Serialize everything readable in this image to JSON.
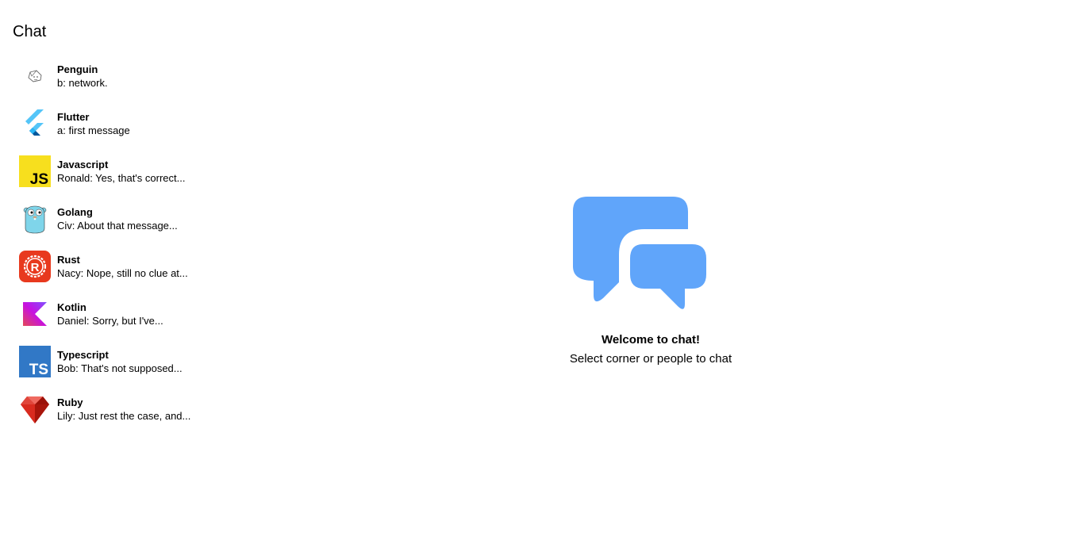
{
  "sidebar": {
    "title": "Chat",
    "items": [
      {
        "name": "Penguin",
        "preview": "b: network.",
        "icon": "penguin-icon"
      },
      {
        "name": "Flutter",
        "preview": "a: first message",
        "icon": "flutter-icon"
      },
      {
        "name": "Javascript",
        "preview": "Ronald: Yes, that's correct...",
        "icon": "javascript-icon"
      },
      {
        "name": "Golang",
        "preview": "Civ: About that message...",
        "icon": "golang-icon"
      },
      {
        "name": "Rust",
        "preview": "Nacy: Nope, still no clue at...",
        "icon": "rust-icon"
      },
      {
        "name": "Kotlin",
        "preview": "Daniel: Sorry, but I've...",
        "icon": "kotlin-icon"
      },
      {
        "name": "Typescript",
        "preview": "Bob: That's not supposed...",
        "icon": "typescript-icon"
      },
      {
        "name": "Ruby",
        "preview": "Lily: Just rest the case, and...",
        "icon": "ruby-icon"
      }
    ]
  },
  "main": {
    "welcome_title": "Welcome to chat!",
    "welcome_subtitle": "Select corner or people to chat",
    "icon": "chat-bubbles-icon",
    "accent_color": "#60a5fa"
  }
}
